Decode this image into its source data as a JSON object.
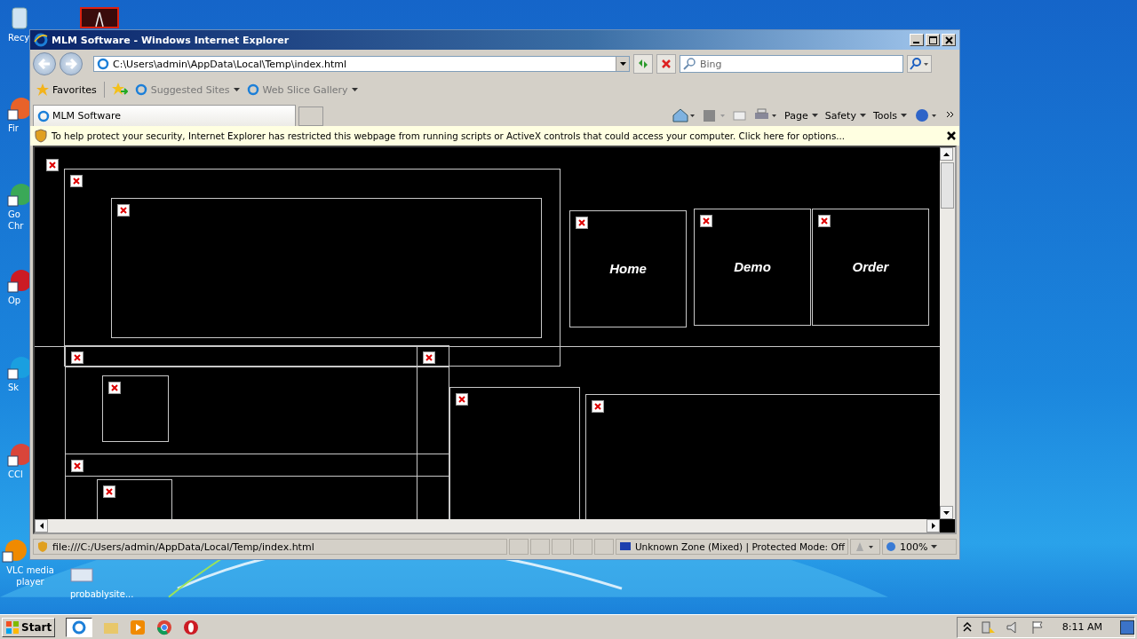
{
  "desktop": {
    "icons": [
      {
        "label": "Recy",
        "kind": "bin"
      },
      {
        "label": "Fir",
        "kind": "firefox"
      },
      {
        "label": "Go Chr",
        "kind": "chrome"
      },
      {
        "label": "Op",
        "kind": "opera"
      },
      {
        "label": "Sk",
        "kind": "skype"
      },
      {
        "label": "CCl",
        "kind": "ccleaner"
      },
      {
        "label": "VLC media player",
        "kind": "vlc"
      },
      {
        "label": "probablysite...",
        "kind": "file"
      }
    ]
  },
  "window": {
    "title": "MLM Software - Windows Internet Explorer"
  },
  "address_bar": {
    "value": "C:\\Users\\admin\\AppData\\Local\\Temp\\index.html"
  },
  "search": {
    "placeholder": "Bing"
  },
  "favorites_bar": {
    "favorites": "Favorites",
    "items": [
      "Suggested Sites",
      "Web Slice Gallery"
    ]
  },
  "tabs": [
    {
      "label": "MLM Software",
      "selected": true
    }
  ],
  "command_bar": [
    "Page",
    "Safety",
    "Tools"
  ],
  "security_bar": {
    "message": "To help protect your security, Internet Explorer has restricted this webpage from running scripts or ActiveX controls that could access your computer. Click here for options..."
  },
  "content": {
    "nav_links": [
      "Home",
      "Demo",
      "Order"
    ]
  },
  "status_bar": {
    "url": "file:///C:/Users/admin/AppData/Local/Temp/index.html",
    "zone": "Unknown Zone (Mixed) | Protected Mode: Off",
    "zoom": "100%"
  },
  "taskbar": {
    "start": "Start",
    "clock": "8:11 AM"
  }
}
